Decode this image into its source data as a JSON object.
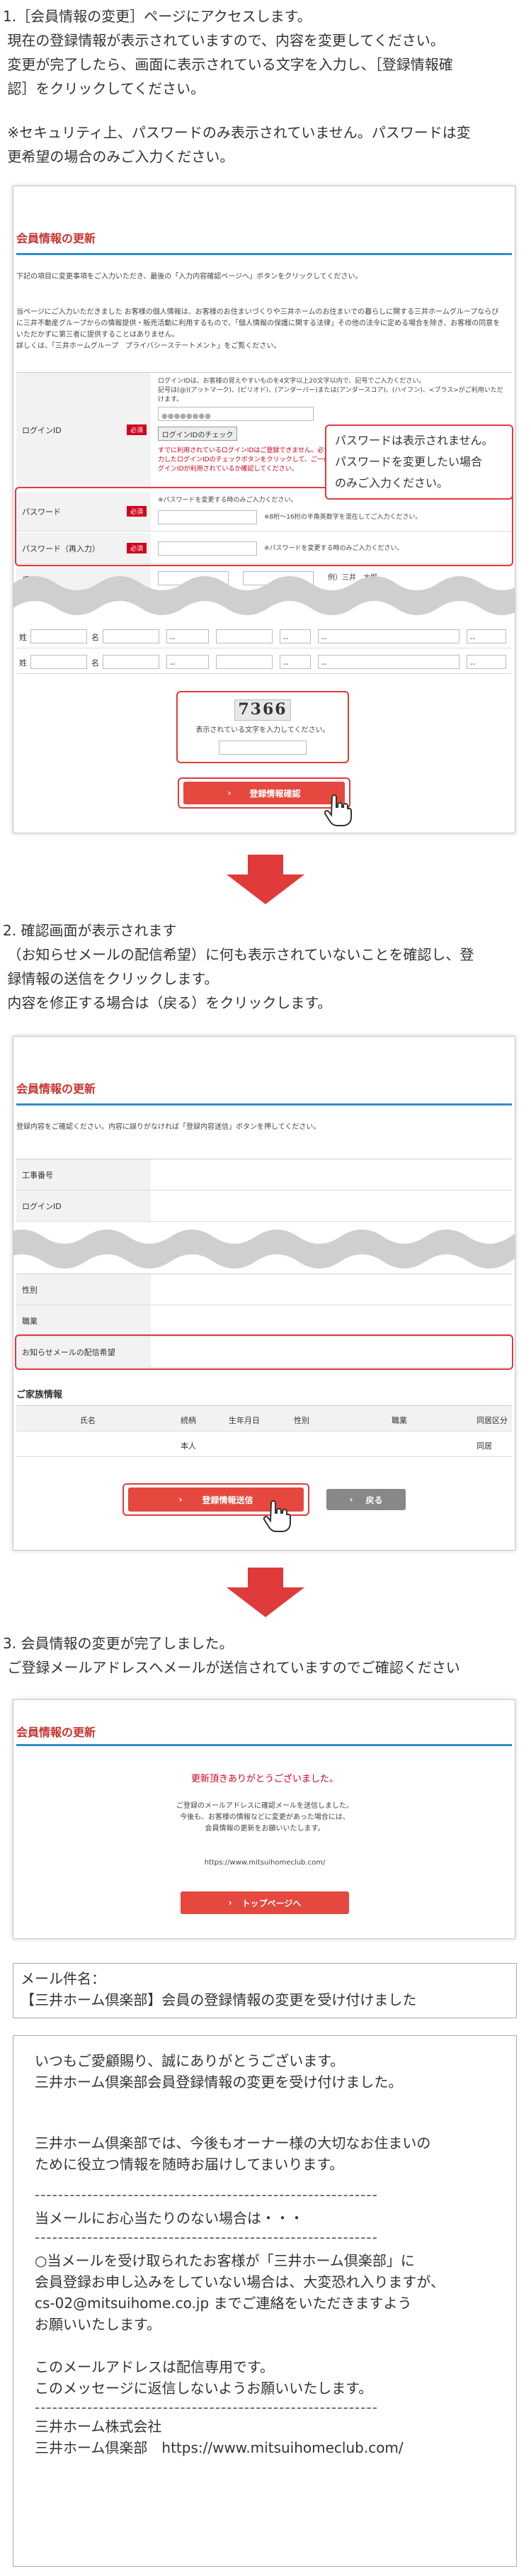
{
  "step1": {
    "text": "1.［会員情報の変更］ページにアクセスします。\n 現在の登録情報が表示されていますので、内容を変更してください。\n 変更が完了したら、画面に表示されている文字を入力し、［登録情報確\n 認］をクリックしてください。",
    "note": " ※セキュリティ上、パスワードのみ表示されていません。パスワードは変\n 更希望の場合のみご入力ください。"
  },
  "screen1": {
    "title": "会員情報の更新",
    "intro": "下記の項目に変更事項をご入力いただき、最後の「入力内容確認ページへ」ボタンをクリックしてください。",
    "privacy": "当ページにご入力いただきました お客様の個人情報は、お客様のお住まいづくりや三井ホームのお住まいでの暮らしに関する三井ホームグループならびに三井不動産グループからの情報提供・販売活動に利用するもので、「個人情報の保護に関する法律」その他の法令に定める場合を除き、お客様の同意をいただかずに第三者に提供することはありません。\n詳しくは、「三井ホームグループ　プライバシーステートメント」をご覧ください。",
    "required_label": "必須",
    "login_id_label": "ログインID",
    "login_id_hint": "ログインIDは、お客様の覚えやすいものを4文字以上20文字以内で、記号でご入力ください。\n記号は(@)(アットマーク)、(ピリオド)、(アンダーバー)または(アンダースコア)、(ハイフン)、<プラス>がご利用いただけます。",
    "check_button": "ログインIDのチェック",
    "login_id_warning": "すでに利用されているログインIDはご登録できません。必ず入力したログインIDのチェックボタンをクリックして、ご一のログインIDが利用されているか確認してください。",
    "password_label": "パスワード",
    "password_hint": "※パスワードを変更する時のみご入力ください。",
    "password_rule": "※8桁〜16桁の半角英数字を混在してご入力ください。",
    "password_confirm_label": "パスワード（再入力）",
    "password_confirm_hint": "※パスワードを変更する時のみご入力ください。",
    "name_label": "氏名",
    "name_example": "例）三井　太郎",
    "callout": "パスワードは表示されません。\nパスワードを変更したい場合\nのみご入力ください。",
    "family_last": "姓",
    "family_first": "名",
    "select_placeholder": "--",
    "captcha": "7366",
    "captcha_prompt": "表示されている文字を入力してください。",
    "confirm_button": "登録情報確認"
  },
  "step2": {
    "text": "2. 確認画面が表示されます\n （お知らせメールの配信希望）に何も表示されていないことを確認し、登\n 録情報の送信をクリックします。\n 内容を修正する場合は（戻る）をクリックします。"
  },
  "screen2": {
    "title": "会員情報の更新",
    "intro": "登録内容をご確認ください。内容に誤りがなければ「登録内容送信」ボタンを押してください。",
    "rows": [
      "工事番号",
      "ログインID",
      "性別",
      "職業",
      "お知らせメールの配信希望"
    ],
    "family_title": "ご家族情報",
    "family_headers": [
      "氏名",
      "続柄",
      "生年月日",
      "性別",
      "職業",
      "同居区分"
    ],
    "family_relation": "本人",
    "family_status": "同居",
    "submit_button": "登録情報送信",
    "back_button": "戻る"
  },
  "step3": {
    "text": "3. 会員情報の変更が完了しました。\n ご登録メールアドレスへメールが送信されていますのでご確認ください"
  },
  "screen3": {
    "title": "会員情報の更新",
    "thanks": "更新頂きありがとうございました。",
    "body": "ご登録のメールアドレスに確認メールを送信しました。\n今後も、お客様の情報などに変更があった場合には、\n会員情報の更新をお願いいたします。",
    "url": "https://www.mitsuihomeclub.com/",
    "top_button": "トップページへ"
  },
  "mail": {
    "subject_label": "メール件名：",
    "subject": "【三井ホーム倶楽部】会員の登録情報の変更を受け付けました",
    "greeting": "いつもご愛顧賜り、誠にありがとうございます。\n三井ホーム倶楽部会員登録情報の変更を受け付けました。",
    "body": "三井ホーム倶楽部では、今後もオーナー様の大切なお住まいの\nために役立つ情報を随時お届けしてまいります。",
    "dashes": "-----------------------------------------------------------",
    "notice_title": "当メールにお心当たりのない場合は・・・",
    "notice": "○当メールを受け取られたお客様が「三井ホーム倶楽部」に\n会員登録お申し込みをしていない場合は、大変恐れ入りますが、\ncs-02@mitsuihome.co.jp までご連絡をいただきますよう\nお願いいたします。",
    "send_only": "このメールアドレスは配信専用です。\nこのメッセージに返信しないようお願いいたします。",
    "company": "三井ホーム株式会社",
    "club": "三井ホーム倶楽部　https://www.mitsuihomeclub.com/"
  }
}
